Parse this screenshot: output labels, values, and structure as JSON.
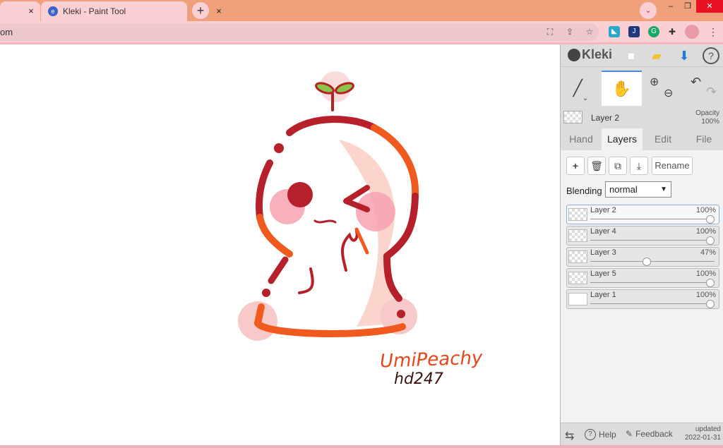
{
  "browser": {
    "tabs": [
      {
        "title": "",
        "close": "×"
      },
      {
        "title": "Kleki - Paint Tool",
        "close": "×",
        "favicon": "e"
      }
    ],
    "new_tab": "+",
    "tab_search": "⌄",
    "window": {
      "min": "–",
      "max": "❐",
      "close": "✕"
    },
    "url": "om",
    "toolbar_icons": [
      "translate-icon",
      "share-icon",
      "star-icon",
      "extension-icon-1",
      "extension-icon-2",
      "grammarly-icon",
      "puzzle-icon",
      "profile-avatar",
      "menu-icon"
    ]
  },
  "canvas": {
    "signature_line1": "UmiPeachy",
    "signature_line2": "hd247"
  },
  "kleki": {
    "logo": "Kleki",
    "header_icons": [
      "new-image-icon",
      "folder-icon",
      "download-icon",
      "help-icon"
    ],
    "tools": [
      "brush",
      "hand",
      "zoom",
      "undo-redo"
    ],
    "current_layer": {
      "name": "Layer 2",
      "opacity_label": "Opacity",
      "opacity": "100%"
    },
    "tabs": [
      {
        "label": "Hand",
        "active": false
      },
      {
        "label": "Layers",
        "active": true
      },
      {
        "label": "Edit",
        "active": false
      },
      {
        "label": "File",
        "active": false
      }
    ],
    "layer_buttons": {
      "add": "+",
      "delete": "🗑",
      "duplicate": "⧉",
      "merge": "⤓",
      "rename": "Rename"
    },
    "blending": {
      "label": "Blending",
      "value": "normal"
    },
    "layers": [
      {
        "name": "Layer 2",
        "opacity": "100%",
        "level": 1.0,
        "selected": true
      },
      {
        "name": "Layer 4",
        "opacity": "100%",
        "level": 1.0,
        "selected": false
      },
      {
        "name": "Layer 3",
        "opacity": "47%",
        "level": 0.47,
        "selected": false
      },
      {
        "name": "Layer 5",
        "opacity": "100%",
        "level": 1.0,
        "selected": false
      },
      {
        "name": "Layer 1",
        "opacity": "100%",
        "level": 1.0,
        "selected": false
      }
    ],
    "footer": {
      "help": "Help",
      "feedback": "Feedback",
      "updated_label": "updated",
      "updated_date": "2022-01-31"
    }
  },
  "colors": {
    "accent": "#4a8ad8",
    "tab_bar": "#f0a07a",
    "tab_active": "#fbd0d5"
  }
}
